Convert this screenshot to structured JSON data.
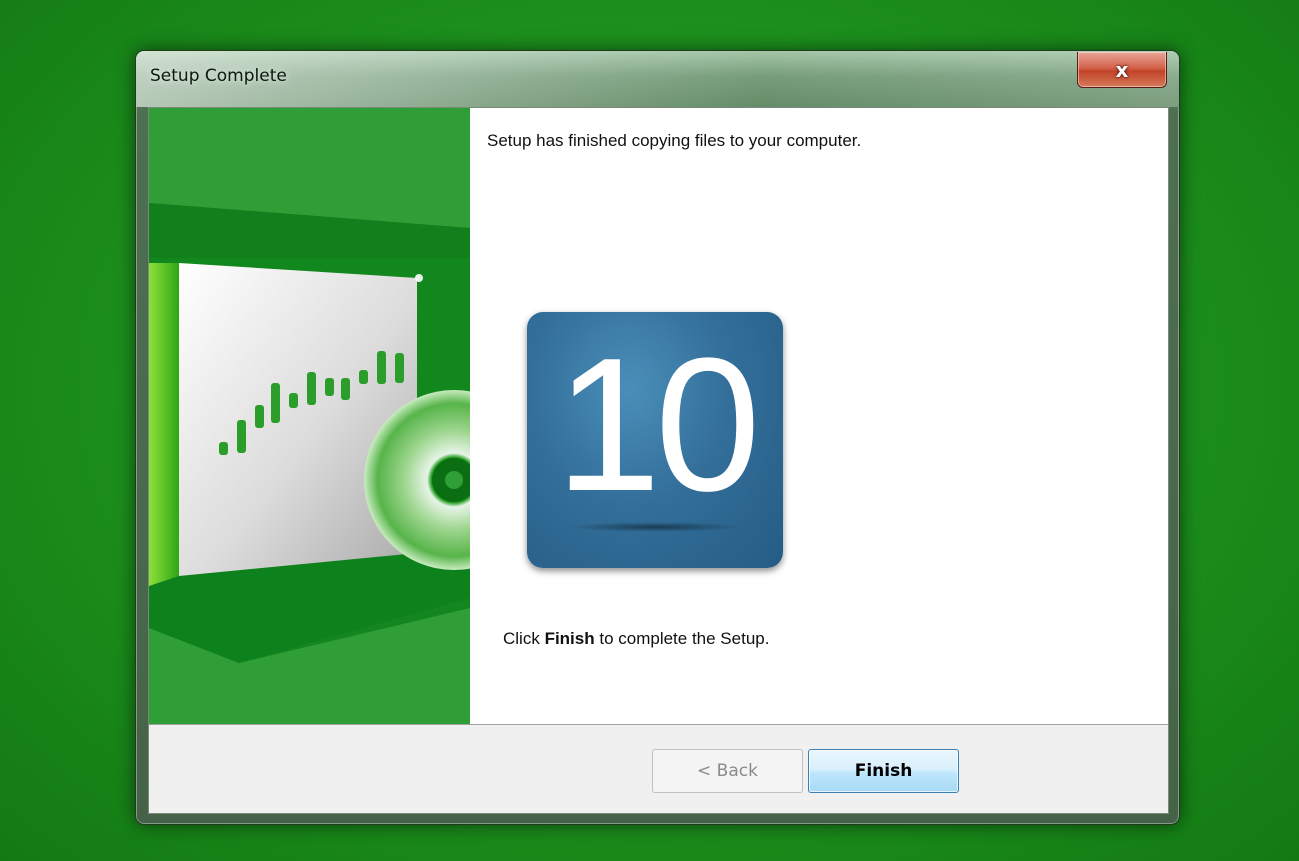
{
  "window": {
    "title": "Setup Complete",
    "close_label": "x"
  },
  "content": {
    "heading": "Setup has finished copying files to your computer.",
    "tile_number": "10",
    "instruction_prefix": "Click ",
    "instruction_bold": "Finish",
    "instruction_suffix": " to complete the Setup."
  },
  "buttons": {
    "back_label": "< Back",
    "finish_label": "Finish"
  },
  "colors": {
    "desktop": "#1c8f1c",
    "side_panel": "#2f9e36",
    "tile": "#336f9a"
  },
  "icons": {
    "side_panel_art": "software-box-with-disc"
  }
}
